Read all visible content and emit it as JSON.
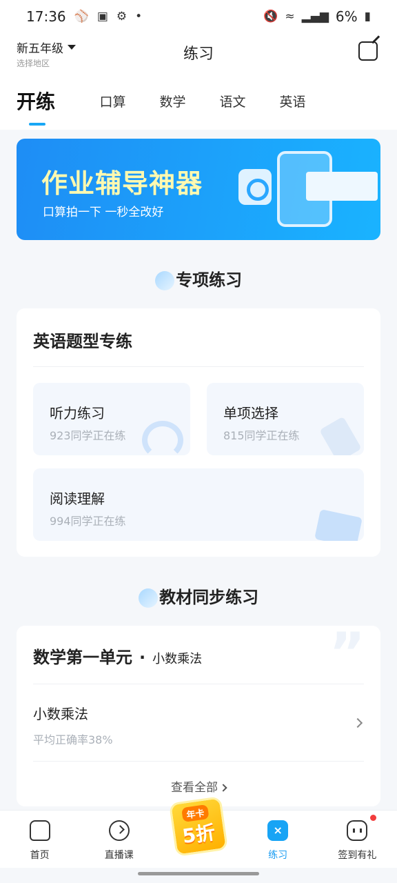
{
  "status_bar": {
    "time": "17:36",
    "battery": "6%",
    "left_icons": [
      "mute-icon",
      "image-icon",
      "gear-icon",
      "dot-icon"
    ],
    "right_icons": [
      "volume-muted-icon",
      "wifi-icon",
      "signal-icon",
      "battery-icon"
    ]
  },
  "header": {
    "grade": "新五年级",
    "region_hint": "选择地区",
    "title": "练习"
  },
  "tabs": {
    "logo_text": "开练",
    "items": [
      "口算",
      "数学",
      "语文",
      "英语"
    ],
    "active_color": "#19a7f5"
  },
  "banner": {
    "title": "作业辅导神器",
    "subtitle": "口算拍一下 一秒全改好"
  },
  "special_practice": {
    "section_title": "专项练习",
    "card_title": "英语题型专练",
    "tiles": [
      {
        "name": "听力练习",
        "count": "923同学正在练"
      },
      {
        "name": "单项选择",
        "count": "815同学正在练"
      },
      {
        "name": "阅读理解",
        "count": "994同学正在练"
      }
    ]
  },
  "textbook_practice": {
    "section_title": "教材同步练习",
    "unit": "数学第一单元",
    "unit_topic": "小数乘法",
    "lesson": {
      "name": "小数乘法",
      "rate": "平均正确率38%"
    },
    "view_all": "查看全部"
  },
  "bottom_nav": {
    "items": [
      {
        "label": "首页"
      },
      {
        "label": "直播课"
      },
      {
        "label": ""
      },
      {
        "label": "练习"
      },
      {
        "label": "签到有礼"
      }
    ],
    "promo": {
      "top": "年卡",
      "main": "5折"
    },
    "active_color": "#1a9cf2"
  }
}
